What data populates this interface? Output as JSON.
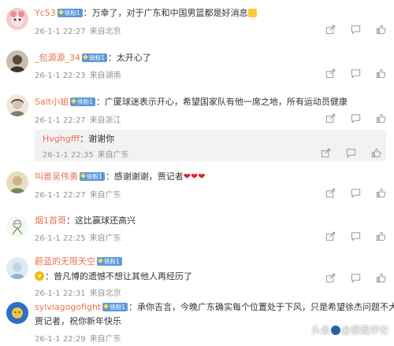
{
  "comments": [
    {
      "username": "Yc53",
      "badge": "铁粉1",
      "text": "：万幸了，对于广东和中国男篮都是好消息",
      "time": "26-1-1 22:27",
      "location": "来自北京",
      "avatar_color": "#f4c9cf",
      "has_emoji": true
    },
    {
      "username": "_包源源_34",
      "badge": "铁粉1",
      "text": "：太开心了",
      "time": "26-1-1 22:23",
      "location": "来自湖南",
      "avatar_color": "#5a4a3e"
    },
    {
      "username": "Salt小姐",
      "badge": "铁粉1",
      "text": "：广厦球迷表示开心，希望国家队有他一席之地，所有运动员健康",
      "time": "26-1-1 22:27",
      "location": "来自浙江",
      "avatar_color": "#d9c2b0",
      "reply": {
        "username": "Hvghgfff",
        "text": "谢谢你",
        "time": "26-1-1 22:35",
        "location": "来自广东"
      }
    },
    {
      "username": "叫兽吴伟勇",
      "badge": "铁粉1",
      "text": "：感谢谢谢，贾记者",
      "hearts": "❤❤❤",
      "time": "26-1-1 22:27",
      "location": "来自广东",
      "avatar_color": "#c9b58a"
    },
    {
      "username": "烟1首哥",
      "text": "：这比赢球还高兴",
      "time": "26-1-1 22:25",
      "location": "来自广东",
      "avatar_color": "#e8efe6"
    },
    {
      "username": "蔚蓝的无限天空",
      "badge": "铁粉1",
      "text": "：曾凡博的遗憾不想让其他人再经历了",
      "time": "26-1-1 22:31",
      "location": "来自北京",
      "avatar_color": "#bfd8e8",
      "verified": true
    },
    {
      "username": "sylviagogofight",
      "badge": "铁粉1",
      "text": "：承你吉言，今晚广东确实每个位置处于下风，只是希望徐杰问题不大，",
      "text2": "贾记者，祝你新年快乐",
      "time": "26-1-1 22:29",
      "location": "来自广东",
      "avatar_color": "#2a70c8"
    }
  ],
  "watermark": {
    "prefix": "头条",
    "suffix": "@狠哉评论"
  },
  "colors": {
    "username": "#eb7350",
    "meta": "#939393",
    "badge": "#5d99da",
    "reply_bg": "#f2f2f5"
  },
  "icons": [
    "share-icon",
    "comment-icon",
    "like-icon"
  ]
}
